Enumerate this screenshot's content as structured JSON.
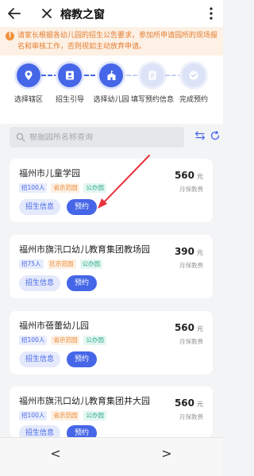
{
  "header": {
    "title": "榕教之窗"
  },
  "notice": {
    "icon": "warning-icon",
    "text": "请家长根据各幼儿园的招生公告要求，参加所申请园所的现场报名和审核工作，否则视如主动放弃申请。"
  },
  "steps": [
    {
      "label": "选择辖区",
      "icon": "map-pin-icon",
      "active": true
    },
    {
      "label": "招生引导",
      "icon": "person-card-icon",
      "active": true
    },
    {
      "label": "选择幼儿园",
      "icon": "school-building-icon",
      "active": true
    },
    {
      "label": "填写预约信息",
      "icon": "form-document-icon",
      "active": false
    },
    {
      "label": "完成预约",
      "icon": "check-circle-icon",
      "active": false
    }
  ],
  "search": {
    "placeholder": "根据园所名称查询"
  },
  "cards": [
    {
      "name": "福州市儿童学园",
      "tags": [
        "招100人",
        "省示范园",
        "公办园"
      ],
      "price": "560",
      "unit": "元",
      "fee_label": "月保教费",
      "info_btn": "招生信息",
      "book_btn": "预约"
    },
    {
      "name": "福州市旗汛口幼儿教育集团教场园",
      "tags": [
        "招75人",
        "区示范园",
        "公办园"
      ],
      "price": "390",
      "unit": "元",
      "fee_label": "月保教费",
      "info_btn": "招生信息",
      "book_btn": "预约"
    },
    {
      "name": "福州市蓓蕾幼儿园",
      "tags": [
        "招100人",
        "省示范园",
        "公办园"
      ],
      "price": "560",
      "unit": "元",
      "fee_label": "月保教费",
      "info_btn": "招生信息",
      "book_btn": "预约"
    },
    {
      "name": "福州市旗汛口幼儿教育集团井大园",
      "tags": [
        "招100人",
        "省示范园",
        "公办园"
      ],
      "price": "560",
      "unit": "元",
      "fee_label": "月保教费",
      "info_btn": "招生信息",
      "book_btn": "预约"
    }
  ],
  "bottom_nav": {
    "back": "<",
    "forward": ">"
  },
  "colors": {
    "accent": "#4666e8",
    "notice_text": "#e47d2f",
    "annotation_arrow": "#e8323c"
  }
}
